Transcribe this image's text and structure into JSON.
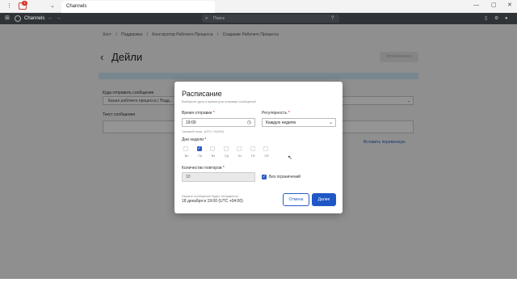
{
  "os": {
    "tab_label": "Channels",
    "badge": "4",
    "minimize": "—",
    "maximize": "▢",
    "close": "✕"
  },
  "app": {
    "name": "Channels",
    "search_placeholder": "Поиск",
    "icons": [
      "grid-icon",
      "search-icon",
      "help-icon",
      "bell-icon",
      "settings-icon",
      "avatar-icon"
    ]
  },
  "page": {
    "breadcrumbs": [
      "Хост",
      "/",
      "Поддержка",
      "/",
      "Конструктор Рабочего Процесса",
      "/",
      "Создание Рабочего Процесса"
    ],
    "title": "Дейли",
    "publish_button": "Опубликовать",
    "where_send_label": "Куда отправить сообщение",
    "where_send_value": "Канал рабочего процесса | Подд...",
    "message_text_label": "Текст сообщения",
    "insert_variable": "Вставить переменную"
  },
  "modal": {
    "title": "Расписание",
    "subtitle": "Выберите дату и время для отправки сообщений",
    "send_time_label": "Время отправки",
    "send_time_value": "19:00",
    "timezone_hint": "Часовой пояс: (UTC +04:00)",
    "frequency_label": "Регулярность",
    "frequency_value": "Каждую неделю",
    "weekdays_label": "Дни недели",
    "weekdays": [
      {
        "name": "Вс",
        "checked": false
      },
      {
        "name": "Пн",
        "checked": true
      },
      {
        "name": "Вт",
        "checked": false
      },
      {
        "name": "Ср",
        "checked": false
      },
      {
        "name": "Чт",
        "checked": false
      },
      {
        "name": "Пт",
        "checked": false
      },
      {
        "name": "Сб",
        "checked": false
      }
    ],
    "repeat_count_label": "Количество повторов",
    "repeat_count_value": "10",
    "unlimited_label": "Без ограничений",
    "unlimited_checked": true,
    "first_message_label": "Первое сообщение будет отправлено",
    "first_message_value": "18 декабря в 19:00 (UTC +04:00)",
    "cancel_button": "Отмена",
    "next_button": "Далее"
  },
  "colors": {
    "primary": "#1f57c7",
    "header_bg": "#2f3236",
    "banner": "#cfe9f7"
  }
}
